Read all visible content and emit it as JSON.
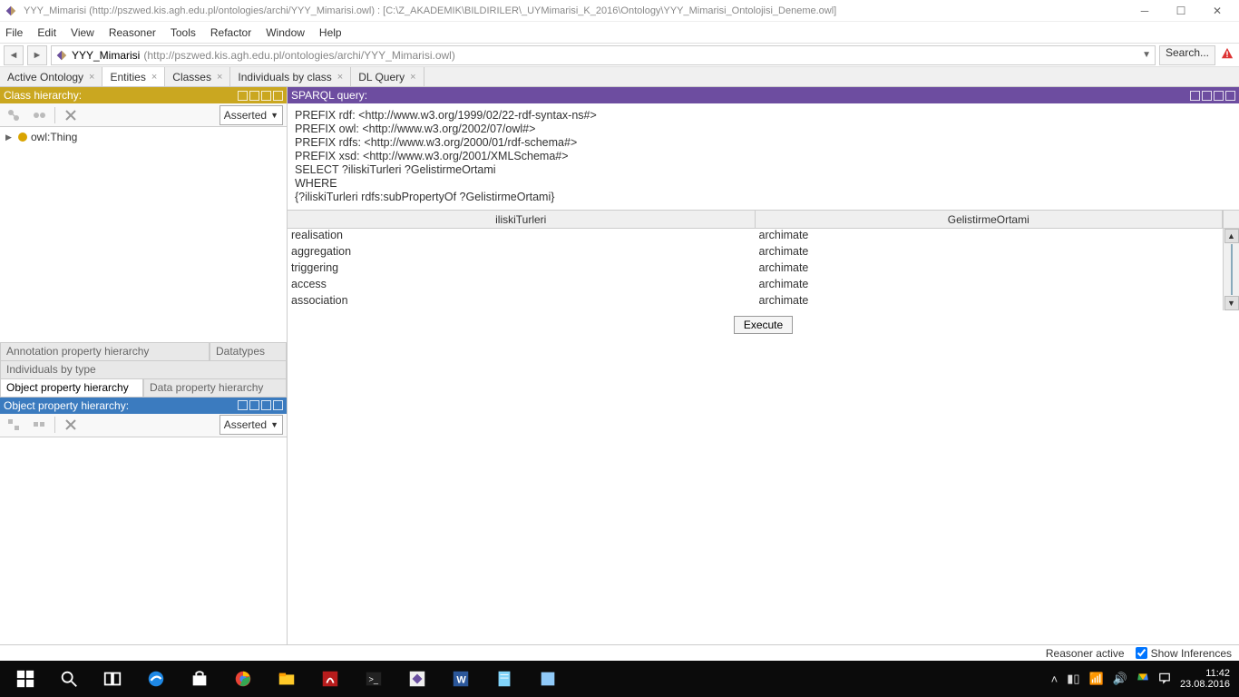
{
  "window": {
    "title": "YYY_Mimarisi (http://pszwed.kis.agh.edu.pl/ontologies/archi/YYY_Mimarisi.owl)  : [C:\\Z_AKADEMIK\\BILDIRILER\\_UYMimarisi_K_2016\\Ontology\\YYY_Mimarisi_Ontolojisi_Deneme.owl]"
  },
  "menu": [
    "File",
    "Edit",
    "View",
    "Reasoner",
    "Tools",
    "Refactor",
    "Window",
    "Help"
  ],
  "nav": {
    "ontology_name": "YYY_Mimarisi",
    "ontology_uri": "(http://pszwed.kis.agh.edu.pl/ontologies/archi/YYY_Mimarisi.owl)",
    "search_label": "Search..."
  },
  "tabs": [
    {
      "label": "Active Ontology",
      "active": false
    },
    {
      "label": "Entities",
      "active": true
    },
    {
      "label": "Classes",
      "active": false
    },
    {
      "label": "Individuals by class",
      "active": false
    },
    {
      "label": "DL Query",
      "active": false
    }
  ],
  "left": {
    "class_panel_title": "Class hierarchy:",
    "asserted_label": "Asserted",
    "tree_root": "owl:Thing",
    "stack": {
      "row1": [
        "Annotation property hierarchy",
        "Datatypes"
      ],
      "row2": [
        "Individuals by type"
      ],
      "row3": [
        "Object property hierarchy",
        "Data property hierarchy"
      ],
      "row3_active_index": 0
    },
    "oph_panel_title": "Object property hierarchy:",
    "oph_asserted_label": "Asserted"
  },
  "right": {
    "panel_title": "SPARQL query:",
    "query_lines": [
      "PREFIX rdf: <http://www.w3.org/1999/02/22-rdf-syntax-ns#>",
      "PREFIX owl: <http://www.w3.org/2002/07/owl#>",
      "PREFIX rdfs: <http://www.w3.org/2000/01/rdf-schema#>",
      "PREFIX xsd: <http://www.w3.org/2001/XMLSchema#>",
      "SELECT  ?iliskiTurleri  ?GelistirmeOrtami",
      "WHERE",
      "{?iliskiTurleri  rdfs:subPropertyOf  ?GelistirmeOrtami}"
    ],
    "columns": [
      "iliskiTurleri",
      "GelistirmeOrtami"
    ],
    "rows": [
      [
        "realisation",
        "archimate"
      ],
      [
        "aggregation",
        "archimate"
      ],
      [
        "triggering",
        "archimate"
      ],
      [
        "access",
        "archimate"
      ],
      [
        "association",
        "archimate"
      ]
    ],
    "execute_label": "Execute"
  },
  "status": {
    "reasoner": "Reasoner active",
    "show_inferences": "Show Inferences",
    "show_inferences_checked": true
  },
  "taskbar": {
    "time": "11:42",
    "date": "23.08.2016"
  }
}
